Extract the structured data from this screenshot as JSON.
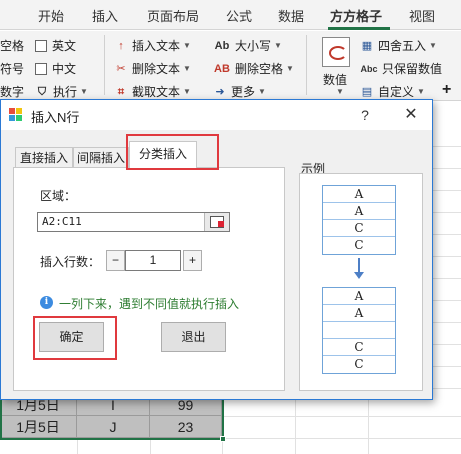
{
  "ribbon": {
    "tabs": [
      "开始",
      "插入",
      "页面布局",
      "公式",
      "数据",
      "方方格子",
      "视图"
    ],
    "active_tab": "方方格子",
    "left_group": {
      "row1": "空格",
      "row2": "符号",
      "row3": "数字"
    },
    "checkboxes": [
      "英文",
      "中文"
    ],
    "execute": "执行",
    "text_tools": [
      "插入文本",
      "删除文本",
      "截取文本"
    ],
    "case_tools": [
      "大小写",
      "删除空格",
      "更多"
    ],
    "value_button": "数值",
    "number_tools": [
      "四舍五入",
      "只保留数值",
      "自定义"
    ],
    "plus": "+"
  },
  "sheet": {
    "rows": [
      [
        "1月5日",
        "I",
        "99"
      ],
      [
        "1月5日",
        "J",
        "23"
      ]
    ]
  },
  "dialog": {
    "title": "插入N行",
    "help": "?",
    "close": "✕",
    "tabs": [
      "直接插入",
      "间隔插入",
      "分类插入"
    ],
    "active_tab": "分类插入",
    "region_label": "区域：",
    "region_value": "A2:C11",
    "rows_label": "插入行数：",
    "minus": "−",
    "rows_value": "1",
    "plus": "+",
    "info_icon": "i",
    "info_text": "一列下来，遇到不同值就执行插入",
    "ok_button": "确定",
    "exit_button": "退出",
    "example_label": "示例",
    "example_before": [
      "A",
      "A",
      "C",
      "C"
    ],
    "example_after": [
      "A",
      "A",
      "",
      "C",
      "C"
    ]
  },
  "colors": {
    "accent": "#217346",
    "highlight": "#e0393e",
    "info_text": "#2e7d32",
    "dialog_border": "#2b79d4"
  }
}
